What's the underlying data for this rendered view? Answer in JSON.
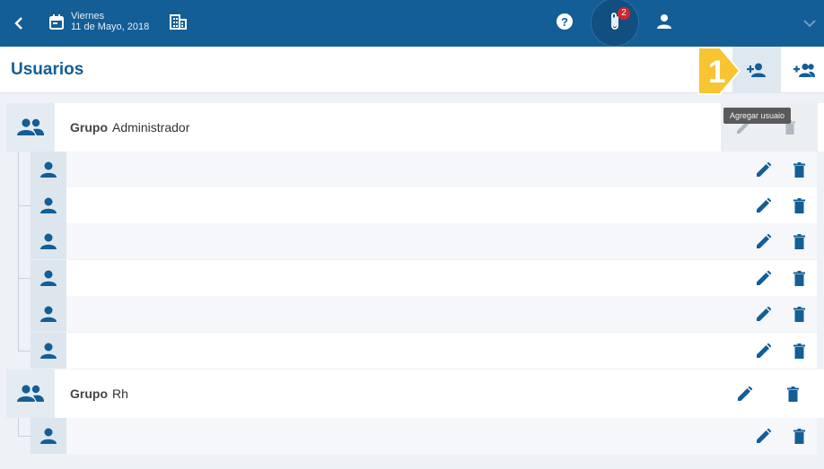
{
  "topbar": {
    "back_icon": "chevron-left-icon",
    "date_day": "Viernes",
    "date_full": "11 de Mayo, 2018",
    "calendar_icon": "calendar-icon",
    "building_icon": "building-icon",
    "help_icon": "help-icon",
    "attachments_count": "2",
    "profile_icon": "person-icon",
    "menu_icon": "chevron-down-icon"
  },
  "header": {
    "title": "Usuarios",
    "add_user_tooltip": "Agregar usuaio",
    "step_number": "1"
  },
  "groups": [
    {
      "prefix": "Grupo",
      "name": "Administrador",
      "user_count": 6
    },
    {
      "prefix": "Grupo",
      "name": "Rh",
      "user_count": 1
    }
  ],
  "colors": {
    "brand": "#135e96",
    "badge": "#d0262d",
    "step": "#f7c531"
  }
}
